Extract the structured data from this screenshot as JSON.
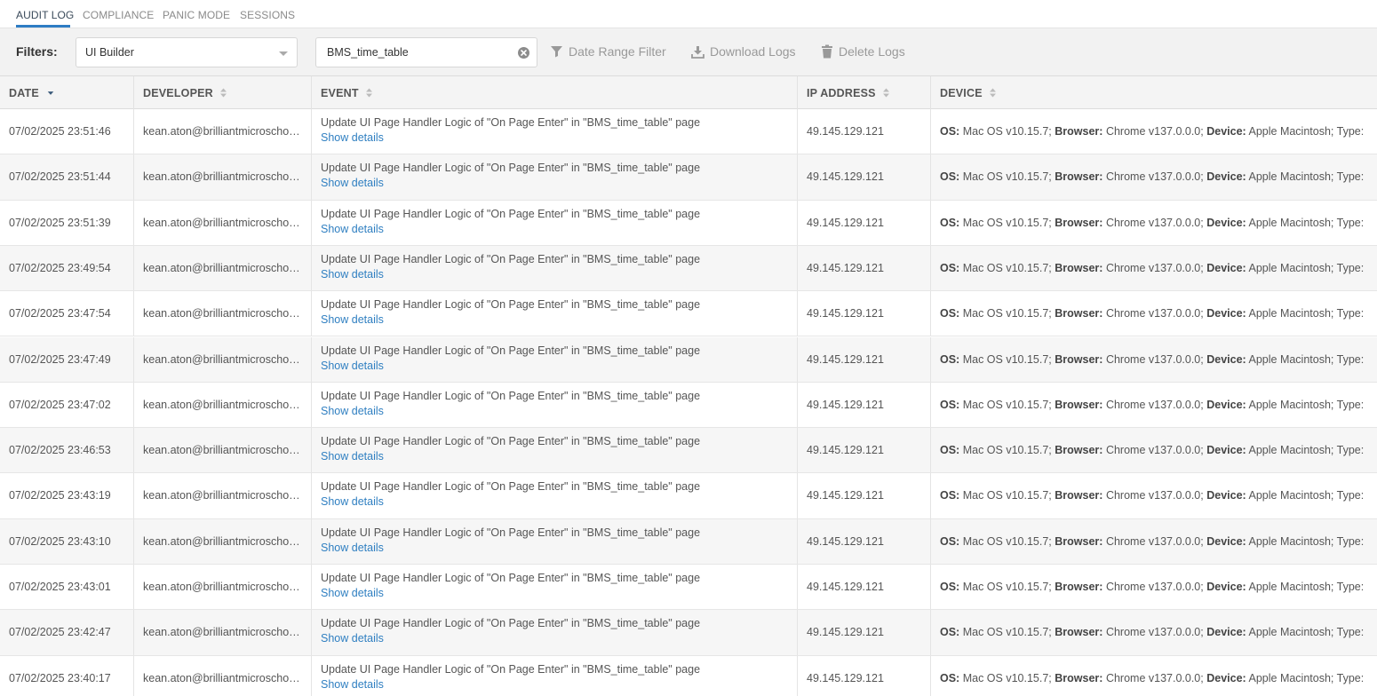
{
  "tabs": [
    {
      "label": "AUDIT LOG",
      "active": true
    },
    {
      "label": "COMPLIANCE",
      "active": false
    },
    {
      "label": "PANIC MODE",
      "active": false
    },
    {
      "label": "SESSIONS",
      "active": false
    }
  ],
  "filters": {
    "label": "Filters:",
    "select_value": "UI Builder",
    "search_value": "BMS_time_table",
    "date_range_label": "Date Range Filter",
    "download_label": "Download Logs",
    "delete_label": "Delete Logs"
  },
  "columns": [
    "DATE",
    "DEVELOPER",
    "EVENT",
    "IP ADDRESS",
    "DEVICE"
  ],
  "device_labels": {
    "os": "OS:",
    "browser": "Browser:",
    "device": "Device:",
    "type": "Type:"
  },
  "show_details_label": "Show details",
  "rows": [
    {
      "date": "07/02/2025 23:51:46",
      "developer": "kean.aton@brilliantmicroschools.com",
      "event": "Update UI Page Handler Logic of \"On Page Enter\" in \"BMS_time_table\" page",
      "ip": "49.145.129.121",
      "os": "Mac OS v10.15.7;",
      "browser": "Chrome v137.0.0.0;",
      "device": "Apple Macintosh;"
    },
    {
      "date": "07/02/2025 23:51:44",
      "developer": "kean.aton@brilliantmicroschools.com",
      "event": "Update UI Page Handler Logic of \"On Page Enter\" in \"BMS_time_table\" page",
      "ip": "49.145.129.121",
      "os": "Mac OS v10.15.7;",
      "browser": "Chrome v137.0.0.0;",
      "device": "Apple Macintosh;"
    },
    {
      "date": "07/02/2025 23:51:39",
      "developer": "kean.aton@brilliantmicroschools.com",
      "event": "Update UI Page Handler Logic of \"On Page Enter\" in \"BMS_time_table\" page",
      "ip": "49.145.129.121",
      "os": "Mac OS v10.15.7;",
      "browser": "Chrome v137.0.0.0;",
      "device": "Apple Macintosh;"
    },
    {
      "date": "07/02/2025 23:49:54",
      "developer": "kean.aton@brilliantmicroschools.com",
      "event": "Update UI Page Handler Logic of \"On Page Enter\" in \"BMS_time_table\" page",
      "ip": "49.145.129.121",
      "os": "Mac OS v10.15.7;",
      "browser": "Chrome v137.0.0.0;",
      "device": "Apple Macintosh;"
    },
    {
      "date": "07/02/2025 23:47:54",
      "developer": "kean.aton@brilliantmicroschools.com",
      "event": "Update UI Page Handler Logic of \"On Page Enter\" in \"BMS_time_table\" page",
      "ip": "49.145.129.121",
      "os": "Mac OS v10.15.7;",
      "browser": "Chrome v137.0.0.0;",
      "device": "Apple Macintosh;"
    },
    {
      "date": "07/02/2025 23:47:49",
      "developer": "kean.aton@brilliantmicroschools.com",
      "event": "Update UI Page Handler Logic of \"On Page Enter\" in \"BMS_time_table\" page",
      "ip": "49.145.129.121",
      "os": "Mac OS v10.15.7;",
      "browser": "Chrome v137.0.0.0;",
      "device": "Apple Macintosh;"
    },
    {
      "date": "07/02/2025 23:47:02",
      "developer": "kean.aton@brilliantmicroschools.com",
      "event": "Update UI Page Handler Logic of \"On Page Enter\" in \"BMS_time_table\" page",
      "ip": "49.145.129.121",
      "os": "Mac OS v10.15.7;",
      "browser": "Chrome v137.0.0.0;",
      "device": "Apple Macintosh;"
    },
    {
      "date": "07/02/2025 23:46:53",
      "developer": "kean.aton@brilliantmicroschools.com",
      "event": "Update UI Page Handler Logic of \"On Page Enter\" in \"BMS_time_table\" page",
      "ip": "49.145.129.121",
      "os": "Mac OS v10.15.7;",
      "browser": "Chrome v137.0.0.0;",
      "device": "Apple Macintosh;"
    },
    {
      "date": "07/02/2025 23:43:19",
      "developer": "kean.aton@brilliantmicroschools.com",
      "event": "Update UI Page Handler Logic of \"On Page Enter\" in \"BMS_time_table\" page",
      "ip": "49.145.129.121",
      "os": "Mac OS v10.15.7;",
      "browser": "Chrome v137.0.0.0;",
      "device": "Apple Macintosh;"
    },
    {
      "date": "07/02/2025 23:43:10",
      "developer": "kean.aton@brilliantmicroschools.com",
      "event": "Update UI Page Handler Logic of \"On Page Enter\" in \"BMS_time_table\" page",
      "ip": "49.145.129.121",
      "os": "Mac OS v10.15.7;",
      "browser": "Chrome v137.0.0.0;",
      "device": "Apple Macintosh;"
    },
    {
      "date": "07/02/2025 23:43:01",
      "developer": "kean.aton@brilliantmicroschools.com",
      "event": "Update UI Page Handler Logic of \"On Page Enter\" in \"BMS_time_table\" page",
      "ip": "49.145.129.121",
      "os": "Mac OS v10.15.7;",
      "browser": "Chrome v137.0.0.0;",
      "device": "Apple Macintosh;"
    },
    {
      "date": "07/02/2025 23:42:47",
      "developer": "kean.aton@brilliantmicroschools.com",
      "event": "Update UI Page Handler Logic of \"On Page Enter\" in \"BMS_time_table\" page",
      "ip": "49.145.129.121",
      "os": "Mac OS v10.15.7;",
      "browser": "Chrome v137.0.0.0;",
      "device": "Apple Macintosh;"
    },
    {
      "date": "07/02/2025 23:40:17",
      "developer": "kean.aton@brilliantmicroschools.com",
      "event": "Update UI Page Handler Logic of \"On Page Enter\" in \"BMS_time_table\" page",
      "ip": "49.145.129.121",
      "os": "Mac OS v10.15.7;",
      "browser": "Chrome v137.0.0.0;",
      "device": "Apple Macintosh;"
    }
  ]
}
